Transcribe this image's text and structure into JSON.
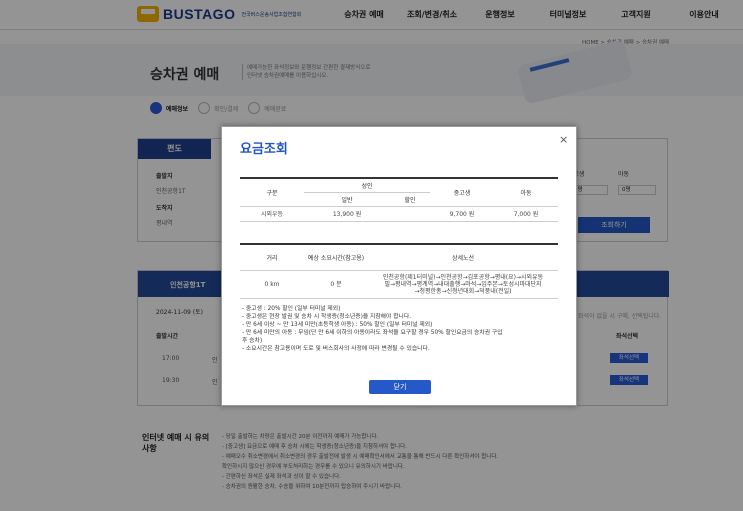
{
  "header": {
    "logo_text": "BUSTAGO",
    "logo_sub": "전국버스운송사업조합연합회",
    "nav": [
      "승차권 예매",
      "조회/변경/취소",
      "운행정보",
      "터미널정보",
      "고객지원",
      "이용안내"
    ]
  },
  "breadcrumb": "HOME  >  승차권 예매  >  승차권 예매",
  "hero": {
    "title": "승차권 예매",
    "desc_line1": "예매가능한 좌석정보와 운행정보 간편한 결제방식으로",
    "desc_line2": "인터넷 승차권예매를 이용하십시오."
  },
  "steps": [
    "예매정보",
    "확인/결제",
    "예매완료"
  ],
  "search_panel": {
    "tab": "편도",
    "departure_label": "출발지",
    "departure_value": "인천공항1T",
    "arrival_label": "도착지",
    "arrival_value": "평내역",
    "senior_label": "중고생",
    "child_label": "아동",
    "senior_value": "0명",
    "child_value": "0명",
    "search_button": "조회하기"
  },
  "list": {
    "header": "인천공항1T",
    "date": "2024-11-09 (토)",
    "col_departure": "출발시간",
    "col_seat": "좌석선택",
    "hint": "좌석이 없을 시 구매, 선택됩니다.",
    "rows": [
      {
        "time": "17:00",
        "company": "인",
        "seat_button": "좌석선택"
      },
      {
        "time": "19:30",
        "company": "인",
        "seat_button": "좌석선택"
      }
    ]
  },
  "notice": {
    "title": "인터넷 예매 시 유의사항",
    "items": [
      "- 당일 출발하는 차량은 출발시간 20분 이전까지 예매가 가능합니다.",
      "- [중고생] 요금으로 예매 후 승차 시에는 학생증(청소년증)을 지참하셔야 합니다.",
      "- 예매오수 취소변경에서 취소변경의 경우 출발전에 발생 시 예매확인서에서 교통을 통해 반드시 다른 확인하셔야 합니다.",
      "  확인하시지 않으신 경우에 부도처리하는 경우를 수 있으니 유의하시기 바랍니다.",
      "- 간편하신 좌석은 실제 좌석과 상이 할 수 있습니다.",
      "- 승차권의 원활한 승차, 수송을 위하여 10분전까지 탑승하여 주시기 바랍니다."
    ]
  },
  "modal": {
    "title": "요금조회",
    "close": "×",
    "fare_table": {
      "col_type": "구분",
      "col_adult": "성인",
      "col_general": "일반",
      "col_discount": "할인",
      "col_student": "중고생",
      "col_child": "아동",
      "row": {
        "type": "시외우등",
        "general": "13,900 원",
        "discount": "",
        "student": "9,700 원",
        "child": "7,000 원"
      }
    },
    "route_table": {
      "col_distance": "거리",
      "col_time": "예상 소요시간(참고용)",
      "col_route": "상세노선",
      "row": {
        "distance": "0 km",
        "time": "0 분",
        "route_line1": "인천공항(제1터미널)→인천공항→김포공항→평내(요)→시외유동",
        "route_line2": "필→평내역→평계역→내대출행→마석→임주본→토성시마대단지",
        "route_line3": "→청평한총→신청년대회→덕풍내(전일)"
      }
    },
    "notes": [
      "- 중고생 : 20% 할인 (일부 터미널 제외)",
      "- 중고생은 현장 발권 및 승차 시 학생증(청소년증)을 지참해야 합니다.",
      "- 만 6세 이상 ~ 만 13세 미만(초등학생 아동) : 50% 할인 (일부 터미널 제외)",
      "- 만 6세 미만의 아동 : 무임(단 만 6세 이하의 아동이라도 좌석을 요구할 경우 50% 할인요금의 승차권 구입",
      "  후 승차)",
      "- 소요시간은 참고용이며 도로 및 버스회사의 사정에 따라 변경될 수 있습니다."
    ],
    "button": "닫기"
  }
}
